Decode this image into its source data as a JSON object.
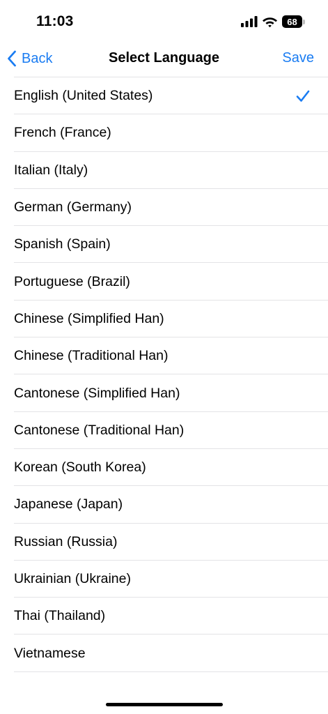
{
  "status_bar": {
    "time": "11:03",
    "battery_level": "68",
    "icons": [
      "signal-icon",
      "wifi-icon",
      "battery-icon"
    ]
  },
  "nav": {
    "back_label": "Back",
    "title": "Select Language",
    "save_label": "Save"
  },
  "colors": {
    "accent": "#1a7cf2",
    "divider": "#e3e3e6",
    "text": "#000000",
    "background": "#ffffff"
  },
  "languages": [
    {
      "label": "English (United States)",
      "selected": true
    },
    {
      "label": "French (France)",
      "selected": false
    },
    {
      "label": "Italian (Italy)",
      "selected": false
    },
    {
      "label": "German (Germany)",
      "selected": false
    },
    {
      "label": "Spanish (Spain)",
      "selected": false
    },
    {
      "label": "Portuguese (Brazil)",
      "selected": false
    },
    {
      "label": "Chinese (Simplified Han)",
      "selected": false
    },
    {
      "label": "Chinese (Traditional Han)",
      "selected": false
    },
    {
      "label": "Cantonese (Simplified Han)",
      "selected": false
    },
    {
      "label": "Cantonese (Traditional Han)",
      "selected": false
    },
    {
      "label": "Korean (South Korea)",
      "selected": false
    },
    {
      "label": "Japanese (Japan)",
      "selected": false
    },
    {
      "label": "Russian (Russia)",
      "selected": false
    },
    {
      "label": "Ukrainian (Ukraine)",
      "selected": false
    },
    {
      "label": "Thai (Thailand)",
      "selected": false
    },
    {
      "label": "Vietnamese",
      "selected": false
    }
  ]
}
